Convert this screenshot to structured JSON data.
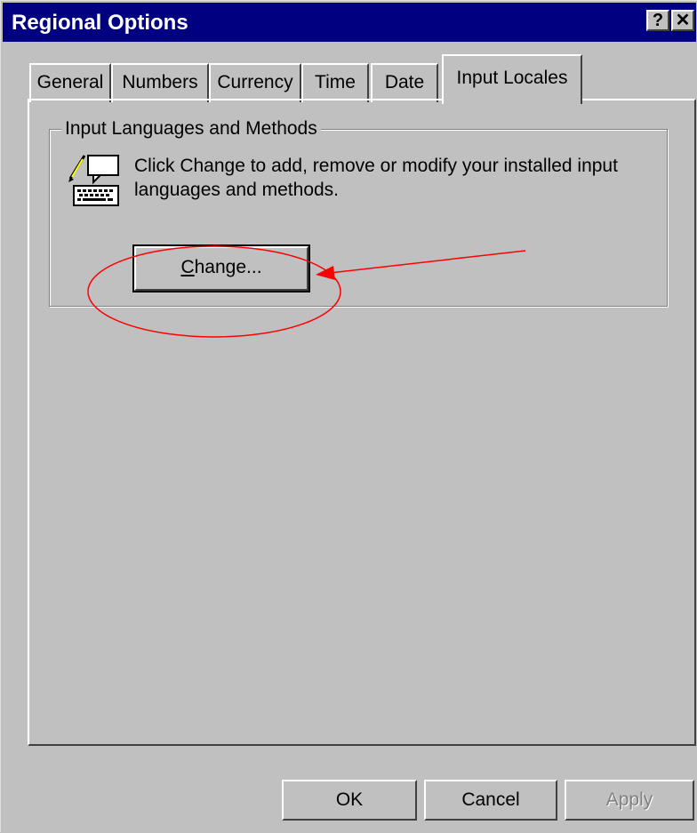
{
  "window": {
    "title": "Regional Options",
    "help_glyph": "?",
    "close_glyph": "✕"
  },
  "tabs": [
    {
      "label": "General",
      "active": false
    },
    {
      "label": "Numbers",
      "active": false
    },
    {
      "label": "Currency",
      "active": false
    },
    {
      "label": "Time",
      "active": false
    },
    {
      "label": "Date",
      "active": false
    },
    {
      "label": "Input Locales",
      "active": true
    }
  ],
  "group": {
    "label": "Input Languages and Methods",
    "description": "Click Change to add, remove or modify your installed input languages and methods.",
    "icon": "keyboard-pencil-icon",
    "change_button": {
      "mnemonic": "C",
      "rest": "hange..."
    }
  },
  "footer": {
    "ok": "OK",
    "cancel": "Cancel",
    "apply": "Apply"
  },
  "colors": {
    "titlebar": "#000080",
    "face": "#c0c0c0",
    "annotation": "#ff0000"
  },
  "annotation": {
    "type": "red ellipse and arrow pointing to the Change button"
  }
}
